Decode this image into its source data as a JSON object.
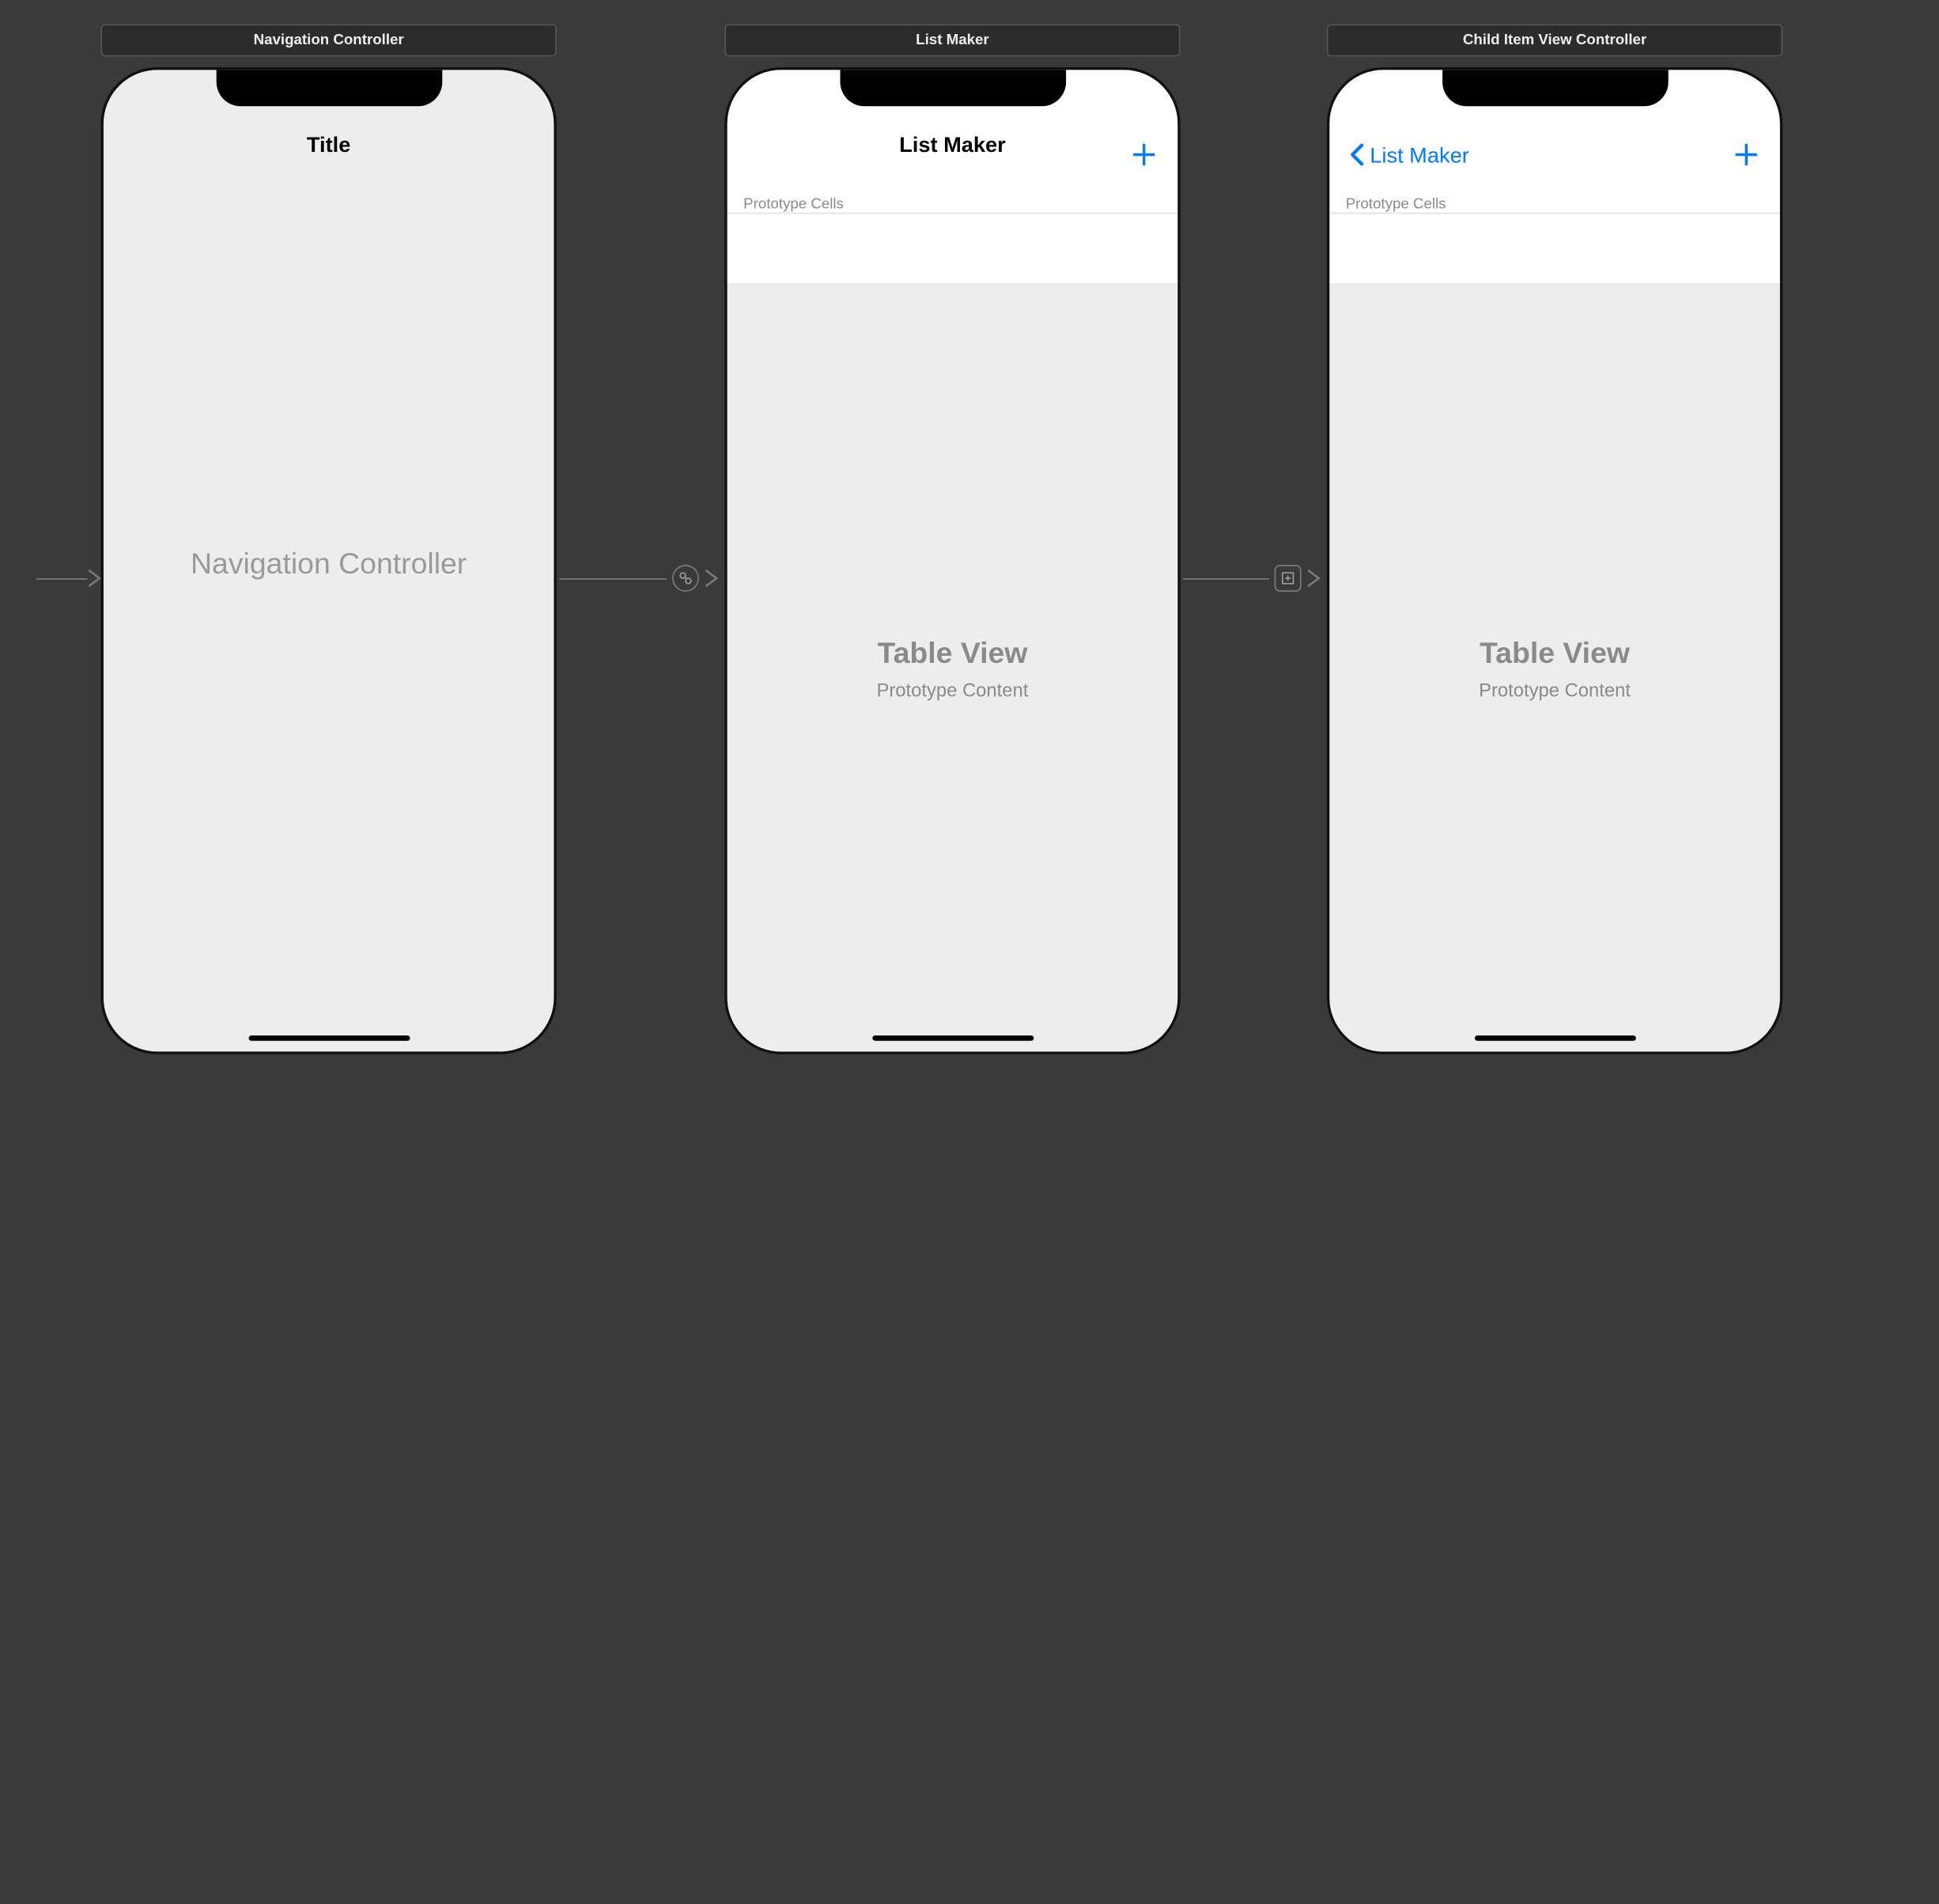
{
  "scenes": {
    "nav": {
      "label": "Navigation Controller",
      "title": "Title",
      "placeholder": "Navigation Controller"
    },
    "list": {
      "label": "List Maker",
      "title": "List Maker",
      "proto_header": "Prototype Cells",
      "table_title": "Table View",
      "table_sub": "Prototype Content"
    },
    "child": {
      "label": "Child Item View Controller",
      "back_label": "List Maker",
      "proto_header": "Prototype Cells",
      "table_title": "Table View",
      "table_sub": "Prototype Content"
    }
  }
}
